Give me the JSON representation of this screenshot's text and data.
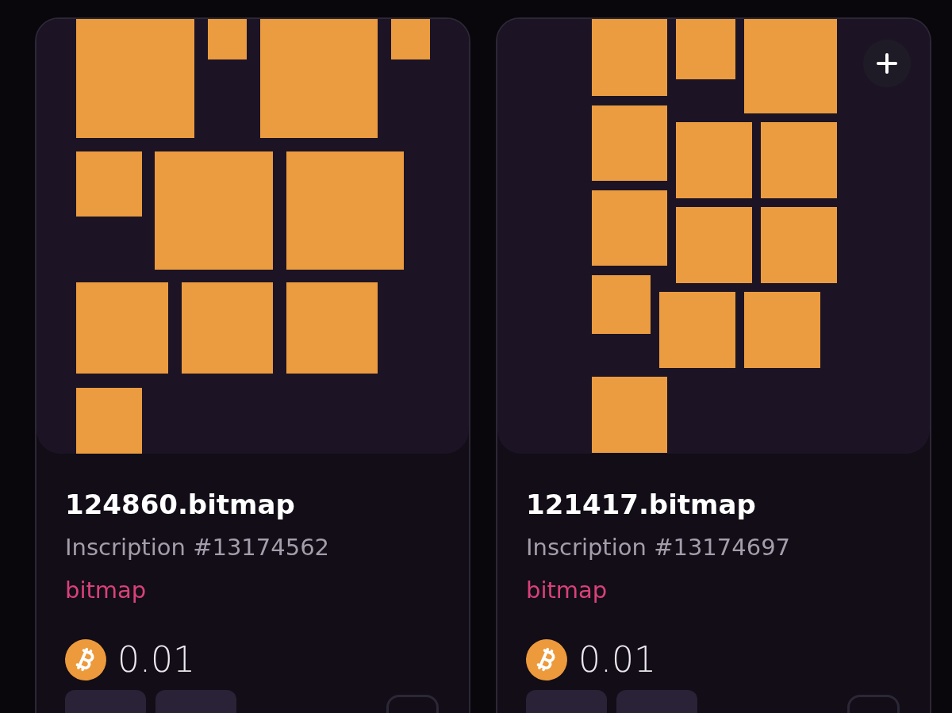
{
  "cards": [
    {
      "title": "124860.bitmap",
      "inscription": "Inscription #13174562",
      "tag": "bitmap",
      "price": "0.01",
      "add_button": false
    },
    {
      "title": "121417.bitmap",
      "inscription": "Inscription #13174697",
      "tag": "bitmap",
      "price": "0.01",
      "add_button": true
    }
  ]
}
